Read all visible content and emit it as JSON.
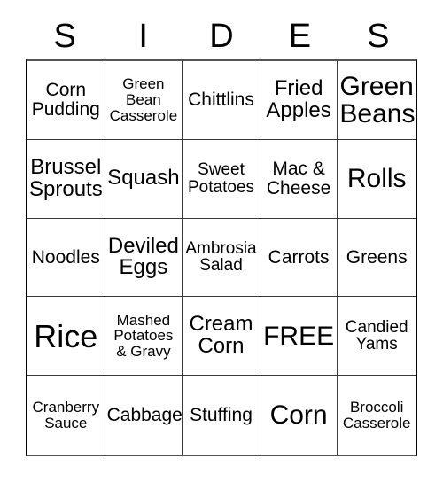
{
  "header": {
    "letters": [
      "S",
      "I",
      "D",
      "E",
      "S"
    ]
  },
  "grid": {
    "columns": 5,
    "rows": 5,
    "cells": [
      {
        "text": "Corn\nPudding",
        "size": "fs-l",
        "free": false
      },
      {
        "text": "Green\nBean\nCasserole",
        "size": "fs-s",
        "free": false
      },
      {
        "text": "Chittlins",
        "size": "fs-l",
        "free": false
      },
      {
        "text": "Fried\nApples",
        "size": "fs-xl",
        "free": false
      },
      {
        "text": "Green\nBeans",
        "size": "fs-xxl",
        "free": false
      },
      {
        "text": "Brussel\nSprouts",
        "size": "fs-xl",
        "free": false
      },
      {
        "text": "Squash",
        "size": "fs-xl",
        "free": false
      },
      {
        "text": "Sweet\nPotatoes",
        "size": "fs-m",
        "free": false
      },
      {
        "text": "Mac &\nCheese",
        "size": "fs-l",
        "free": false
      },
      {
        "text": "Rolls",
        "size": "fs-xxl",
        "free": false
      },
      {
        "text": "Noodles",
        "size": "fs-l",
        "free": false
      },
      {
        "text": "Deviled\nEggs",
        "size": "fs-xl",
        "free": false
      },
      {
        "text": "Ambrosia\nSalad",
        "size": "fs-m",
        "free": false
      },
      {
        "text": "Carrots",
        "size": "fs-l",
        "free": false
      },
      {
        "text": "Greens",
        "size": "fs-l",
        "free": false
      },
      {
        "text": "Rice",
        "size": "fs-huge",
        "free": false
      },
      {
        "text": "Mashed\nPotatoes\n& Gravy",
        "size": "fs-s",
        "free": false
      },
      {
        "text": "Cream\nCorn",
        "size": "fs-xl",
        "free": false
      },
      {
        "text": "FREE",
        "size": "fs-xxl",
        "free": true
      },
      {
        "text": "Candied\nYams",
        "size": "fs-m",
        "free": false
      },
      {
        "text": "Cranberry\nSauce",
        "size": "fs-s",
        "free": false
      },
      {
        "text": "Cabbage",
        "size": "fs-l",
        "free": false
      },
      {
        "text": "Stuffing",
        "size": "fs-l",
        "free": false
      },
      {
        "text": "Corn",
        "size": "fs-xxl",
        "free": false
      },
      {
        "text": "Broccoli\nCasserole",
        "size": "fs-s",
        "free": false
      }
    ]
  },
  "colors": {
    "background": "#ffffff",
    "text": "#000000",
    "grid_line": "#3a3a3a",
    "outer_border": "#000000"
  }
}
